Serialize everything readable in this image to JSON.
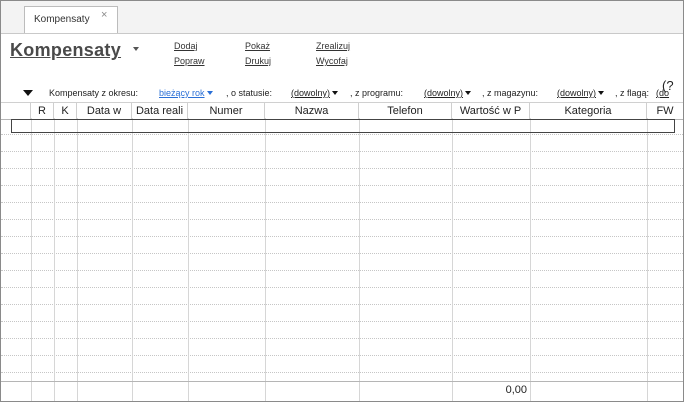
{
  "tab": {
    "label": "Kompensaty",
    "close": "×"
  },
  "header": {
    "title": "Kompensaty"
  },
  "actions": {
    "dodaj": "Dodaj",
    "popraw": "Popraw",
    "pokaz": "Pokaż",
    "drukuj": "Drukuj",
    "zrealizuj": "Zrealizuj",
    "wycofaj": "Wycofaj"
  },
  "filters": {
    "period_label": "Kompensaty z okresu:",
    "period_value": "bieżący rok",
    "status_label": ", o statusie:",
    "status_value": "(dowolny)",
    "program_label": ", z programu:",
    "program_value": "(dowolny)",
    "warehouse_label": ", z magazynu:",
    "warehouse_value": "(dowolny)",
    "flag_label": ", z flagą:",
    "flag_value": "(do",
    "edge_glyph": "(?"
  },
  "columns": [
    "R",
    "K",
    "Data w",
    "Data reali",
    "Numer",
    "Nazwa",
    "Telefon",
    "Wartość w P",
    "Kategoria",
    "FW"
  ],
  "footer": {
    "total": "0,00"
  },
  "colors": {
    "link_blue": "#2a6fd6",
    "title_gray": "#4a4a4a"
  },
  "icons": {
    "close": "close-icon",
    "expand": "triangle-down-icon",
    "dropdown": "caret-down-icon"
  }
}
